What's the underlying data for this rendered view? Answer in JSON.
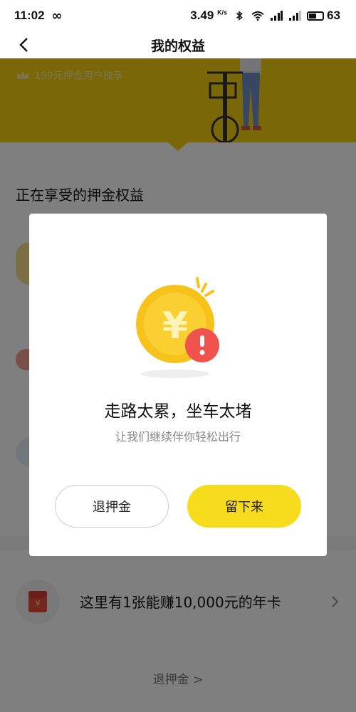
{
  "status_bar": {
    "time": "11:02",
    "loop_glyph": "∞",
    "net_speed": "3.49",
    "net_unit": "K/s",
    "battery": "63"
  },
  "nav": {
    "title": "我的权益",
    "back_icon": "chevron-left-icon"
  },
  "banner": {
    "tag": "199元押金用户独享"
  },
  "section": {
    "title": "正在享受的押金权益"
  },
  "promo": {
    "text": "这里有1张能赚10,000元的年卡",
    "icon_glyph": "¥"
  },
  "footer": {
    "link": "退押金 >"
  },
  "dialog": {
    "coin_glyph": "¥",
    "alert_glyph": "!",
    "headline": "走路太累，坐车太堵",
    "subtext": "让我们继续伴你轻松出行",
    "refund_button": "退押金",
    "stay_button": "留下来"
  },
  "colors": {
    "accent_yellow": "#f7dc1e",
    "banner_yellow": "#f5cf10",
    "alert_red": "#f0524d",
    "coin_gold": "#f7c21a"
  }
}
